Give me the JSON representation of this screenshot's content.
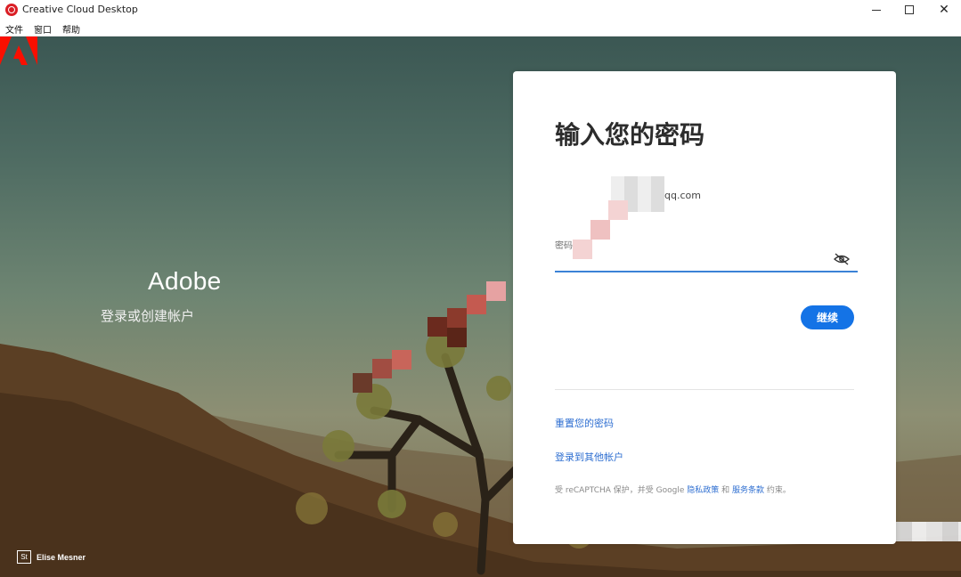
{
  "window": {
    "title": "Creative Cloud Desktop",
    "controls": {
      "minimize": "—",
      "maximize": "□",
      "close": "✕"
    }
  },
  "menu": [
    "文件",
    "窗口",
    "帮助"
  ],
  "brand": {
    "name": "Adobe",
    "tagline": "登录或创建帐户",
    "accent": "#fa0f00"
  },
  "photo_credit": {
    "badge": "St",
    "author": "Elise Mesner"
  },
  "card": {
    "title": "输入您的密码",
    "email": "qq.com",
    "password_label": "密码",
    "password_value": "",
    "continue_label": "继续",
    "reset_link": "重置您的密码",
    "other_account_link": "登录到其他帐户",
    "legal": {
      "prefix": "受 reCAPTCHA 保护，并受 Google ",
      "privacy": "隐私政策",
      "and": " 和 ",
      "terms": "服务条款",
      "suffix": " 约束。"
    }
  },
  "colors": {
    "primary_button": "#1473e6",
    "link": "#2f6fd1",
    "focus_underline": "#3b82d6"
  }
}
